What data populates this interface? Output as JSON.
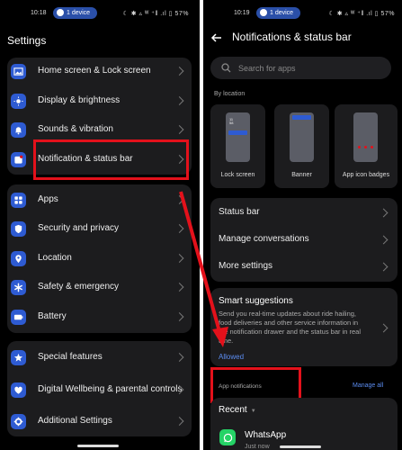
{
  "left": {
    "status": {
      "time": "10:18",
      "device": "1 device",
      "icons": "☾ ✱ ▵ ᵂ ⁺‖ .ıl ▯ 57%"
    },
    "title": "Settings",
    "items": [
      {
        "label": "Home screen & Lock screen",
        "icon": "image-icon"
      },
      {
        "label": "Display & brightness",
        "icon": "sun-icon"
      },
      {
        "label": "Sounds & vibration",
        "icon": "bell-icon"
      },
      {
        "label": "Notification & status bar",
        "icon": "notification-icon"
      },
      {
        "label": "Apps",
        "icon": "apps-grid-icon"
      },
      {
        "label": "Security and privacy",
        "icon": "shield-icon"
      },
      {
        "label": "Location",
        "icon": "location-pin-icon"
      },
      {
        "label": "Safety & emergency",
        "icon": "asterisk-icon"
      },
      {
        "label": "Battery",
        "icon": "battery-icon"
      },
      {
        "label": "Special features",
        "icon": "star-icon"
      },
      {
        "label": "Digital Wellbeing & parental controls",
        "icon": "wellbeing-icon"
      },
      {
        "label": "Additional Settings",
        "icon": "gear-icon"
      }
    ]
  },
  "right": {
    "status": {
      "time": "10:19",
      "device": "1 device",
      "icons": "☾ ✱ ▵ ᵂ ⁺‖ .ıl ▯ 57%"
    },
    "title": "Notifications & status bar",
    "search_placeholder": "Search for apps",
    "by_location": "By location",
    "tiles": [
      "Lock screen",
      "Banner",
      "App icon badges"
    ],
    "settings_rows": [
      "Status bar",
      "Manage conversations",
      "More settings"
    ],
    "smart": {
      "title": "Smart suggestions",
      "desc": "Send you real-time updates about ride hailing, food deliveries and other service information in the notification drawer and the status bar in real time.",
      "status": "Allowed"
    },
    "app_notifications": "App notifications",
    "manage_all": "Manage all",
    "recent": "Recent",
    "app": {
      "name": "WhatsApp",
      "sub": "Just now"
    }
  },
  "colors": {
    "accent": "#2e5bd2",
    "highlight": "#e3111b",
    "link": "#5b8cf0",
    "card": "#1c1c1e"
  }
}
